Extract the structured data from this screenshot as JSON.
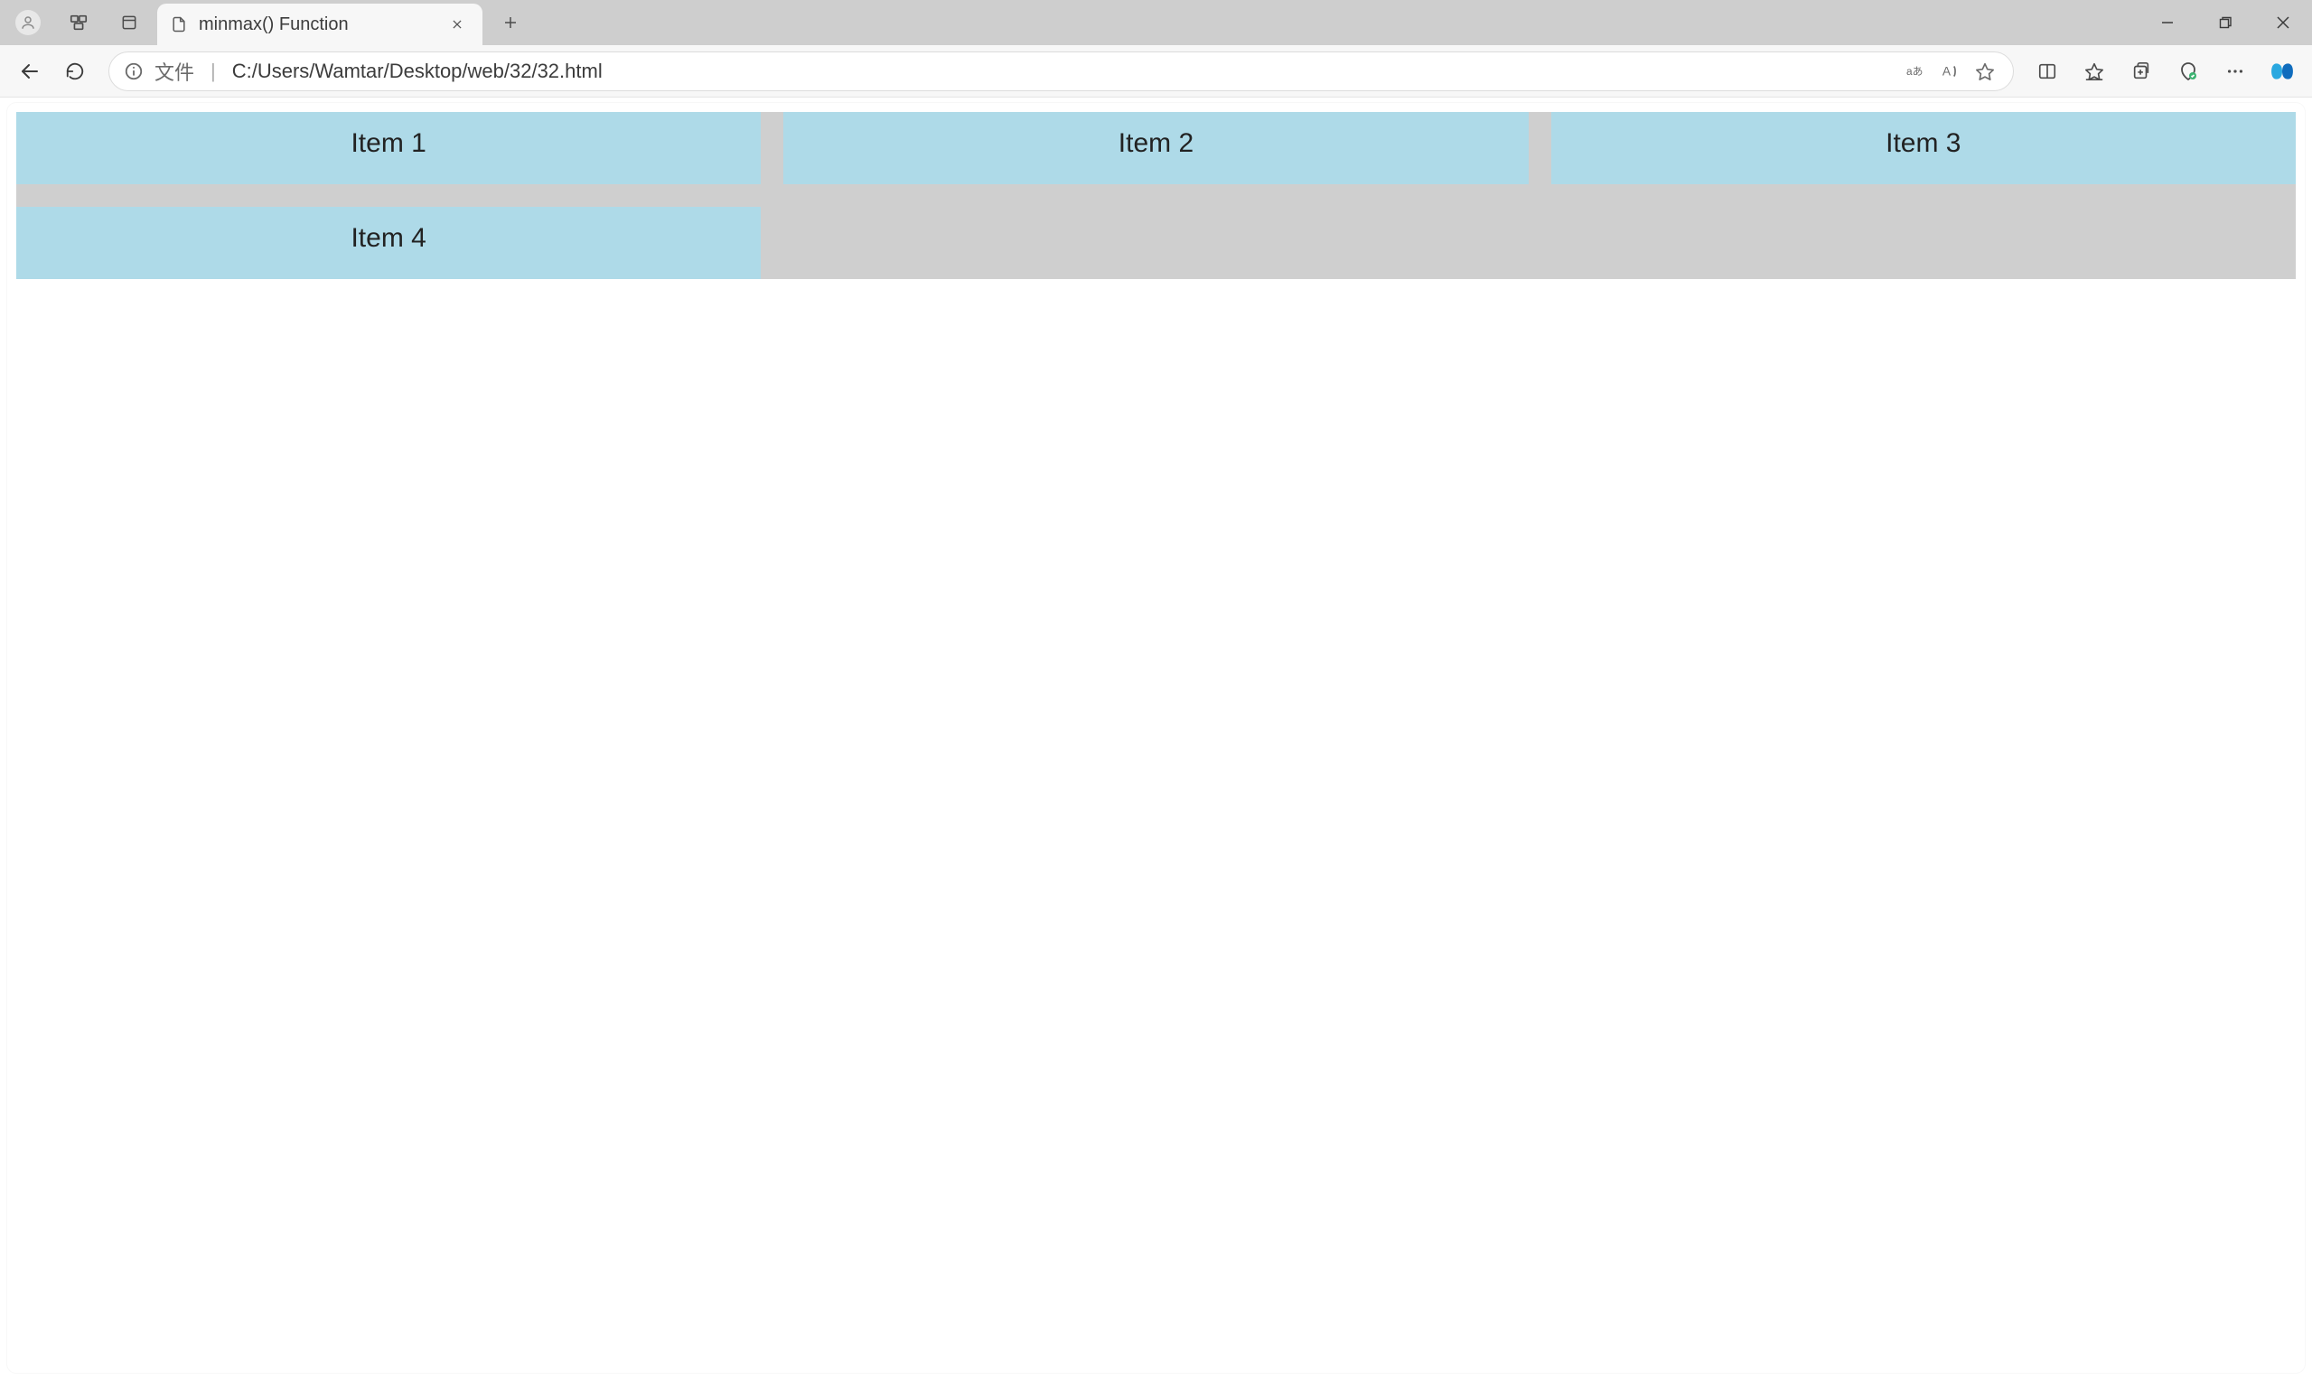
{
  "tab": {
    "title": "minmax() Function"
  },
  "address": {
    "origin_label": "文件",
    "url": "C:/Users/Wamtar/Desktop/web/32/32.html"
  },
  "grid": {
    "items": [
      "Item 1",
      "Item 2",
      "Item 3",
      "Item 4"
    ]
  },
  "icons": {
    "profile": "profile-icon",
    "workspaces": "workspaces-icon",
    "tab_actions": "tab-actions-icon",
    "page": "page-icon",
    "close": "close-icon",
    "new_tab": "plus-icon",
    "minimize": "minimize-icon",
    "maximize": "restore-icon",
    "window_close": "window-close-icon",
    "back": "back-icon",
    "refresh": "refresh-icon",
    "info": "info-icon",
    "translate": "translate-icon",
    "read_aloud": "read-aloud-icon",
    "star": "star-icon",
    "split": "split-screen-icon",
    "favorites": "favorites-icon",
    "collections": "collections-icon",
    "performance": "browser-essentials-icon",
    "more": "more-icon",
    "copilot": "copilot-icon"
  }
}
